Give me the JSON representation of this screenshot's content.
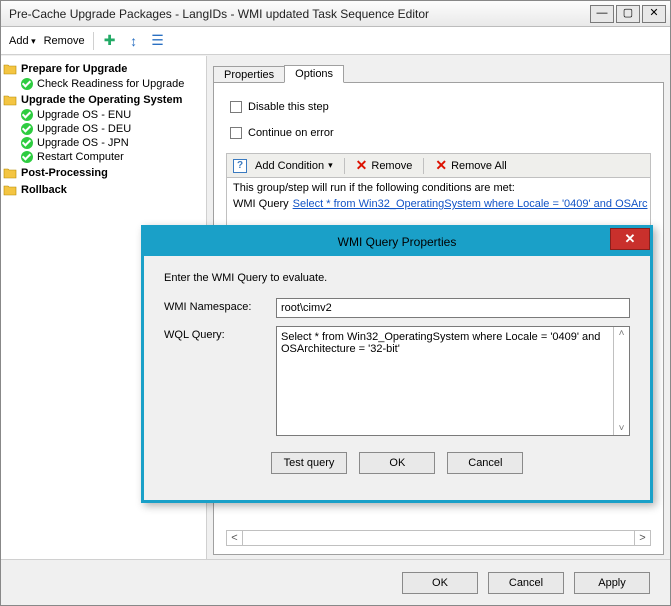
{
  "window": {
    "title": "Pre-Cache Upgrade Packages - LangIDs - WMI updated Task Sequence Editor"
  },
  "toolbar": {
    "add": "Add",
    "remove": "Remove"
  },
  "tree": {
    "groups": [
      {
        "label": "Prepare for Upgrade",
        "items": [
          {
            "label": "Check Readiness for Upgrade"
          }
        ]
      },
      {
        "label": "Upgrade the Operating System",
        "items": [
          {
            "label": "Upgrade OS - ENU"
          },
          {
            "label": "Upgrade OS - DEU"
          },
          {
            "label": "Upgrade OS - JPN"
          },
          {
            "label": "Restart Computer"
          }
        ]
      },
      {
        "label": "Post-Processing",
        "items": []
      },
      {
        "label": "Rollback",
        "items": []
      }
    ]
  },
  "tabs": {
    "properties": "Properties",
    "options": "Options"
  },
  "options": {
    "disable_step": "Disable this step",
    "continue_on_error": "Continue on error",
    "cond_toolbar": {
      "add": "Add Condition",
      "remove": "Remove",
      "remove_all": "Remove All"
    },
    "cond_heading": "This group/step will run if the following conditions are met:",
    "cond_row": {
      "prefix": "WMI Query",
      "link": "Select * from Win32_OperatingSystem where Locale = '0409' and OSArc"
    }
  },
  "footer": {
    "ok": "OK",
    "cancel": "Cancel",
    "apply": "Apply"
  },
  "dialog": {
    "title": "WMI Query Properties",
    "instr": "Enter the WMI Query to evaluate.",
    "namespace_label": "WMI Namespace:",
    "namespace_value": "root\\cimv2",
    "query_label": "WQL Query:",
    "query_value": "Select * from Win32_OperatingSystem where Locale = '0409' and OSArchitecture = '32-bit'",
    "test": "Test query",
    "ok": "OK",
    "cancel": "Cancel"
  }
}
